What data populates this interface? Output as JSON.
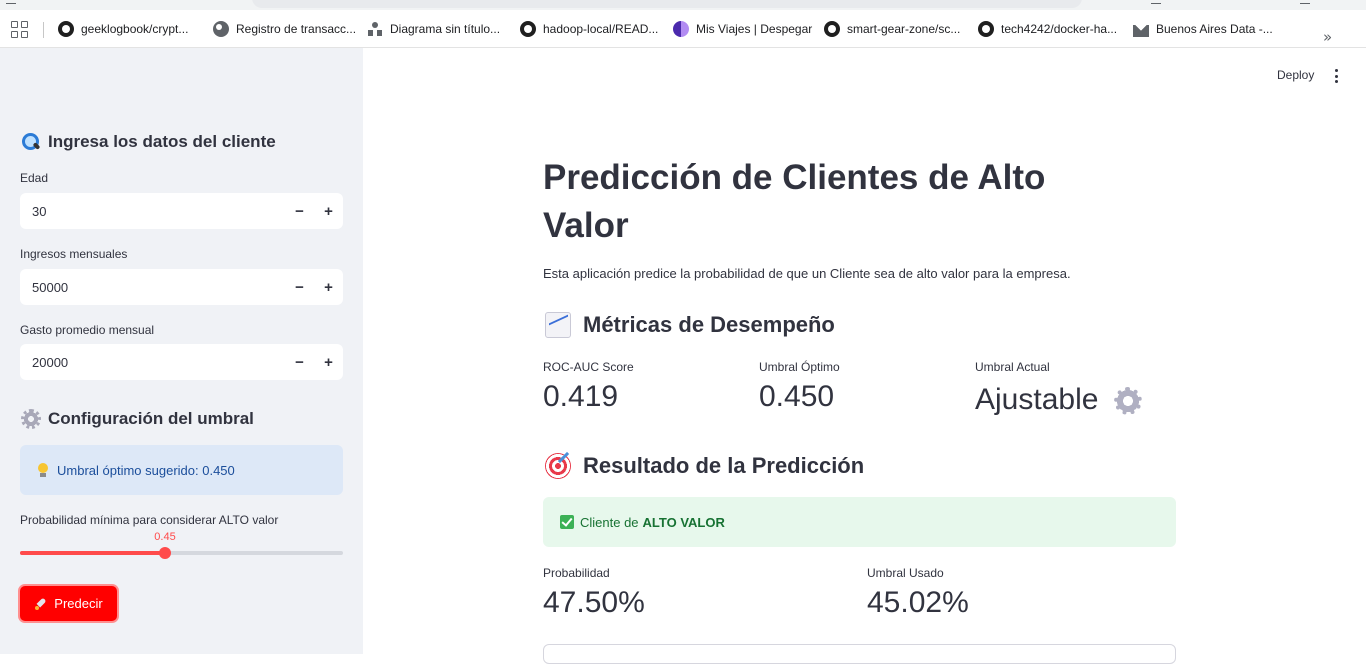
{
  "bookmarks": [
    {
      "icon": "github-icon",
      "label": "geeklogbook/crypt..."
    },
    {
      "icon": "globe-icon",
      "label": "Registro de transacc..."
    },
    {
      "icon": "diagram-icon",
      "label": "Diagrama sin título..."
    },
    {
      "icon": "github-icon",
      "label": "hadoop-local/READ..."
    },
    {
      "icon": "despegar-icon",
      "label": "Mis Viajes | Despegar"
    },
    {
      "icon": "github-icon",
      "label": "smart-gear-zone/sc..."
    },
    {
      "icon": "github-icon",
      "label": "tech4242/docker-ha..."
    },
    {
      "icon": "mountain-icon",
      "label": "Buenos Aires Data -..."
    }
  ],
  "sidebar": {
    "client_header": "Ingresa los datos del cliente",
    "fields": [
      {
        "label": "Edad",
        "value": "30"
      },
      {
        "label": "Ingresos mensuales",
        "value": "50000"
      },
      {
        "label": "Gasto promedio mensual",
        "value": "20000"
      }
    ],
    "step_minus": "−",
    "step_plus": "+",
    "threshold_header": "Configuración del umbral",
    "info_text": "Umbral óptimo sugerido: 0.450",
    "slider_label": "Probabilidad mínima para considerar ALTO valor",
    "slider_value": "0.45",
    "slider_min": 0,
    "slider_max": 1,
    "predict_label": "Predecir"
  },
  "main": {
    "deploy_label": "Deploy",
    "title": "Predicción de Clientes de Alto Valor",
    "description": "Esta aplicación predice la probabilidad de que un Cliente sea de alto valor para la empresa.",
    "metrics_header": "Métricas de Desempeño",
    "metrics": [
      {
        "label": "ROC-AUC Score",
        "value": "0.419"
      },
      {
        "label": "Umbral Óptimo",
        "value": "0.450"
      },
      {
        "label": "Umbral Actual",
        "value": "Ajustable"
      }
    ],
    "result_header": "Resultado de la Predicción",
    "result_prefix": "Cliente de",
    "result_strong": "ALTO VALOR",
    "result_metrics": [
      {
        "label": "Probabilidad",
        "value": "47.50%"
      },
      {
        "label": "Umbral Usado",
        "value": "45.02%"
      }
    ]
  },
  "colors": {
    "accent": "#ff4b4b",
    "sidebar_bg": "#f0f2f6",
    "info_bg": "#dde8f7",
    "success_bg": "#e7f8ec",
    "button_bg": "#ff0000"
  }
}
